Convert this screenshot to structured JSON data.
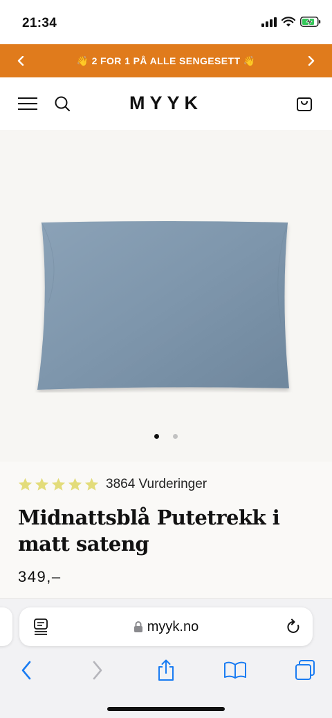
{
  "status_bar": {
    "time": "21:34"
  },
  "promo": {
    "text": "👋 2 FOR 1 PÅ ALLE SENGESETT 👋"
  },
  "header": {
    "logo": "MYYK"
  },
  "gallery": {
    "image_count": 2,
    "active_index": 0,
    "image_color": "#7d95ab"
  },
  "product": {
    "rating_value": 5,
    "rating_text": "3864 Vurderinger",
    "title": "Midnattsblå Putetrekk i matt sateng",
    "price": "349,–"
  },
  "browser": {
    "url": "myyk.no"
  },
  "colors": {
    "promo_bg": "#e07b1c",
    "star": "#e3dc7a",
    "ios_blue": "#1a7cf2",
    "battery_green": "#34c759"
  }
}
